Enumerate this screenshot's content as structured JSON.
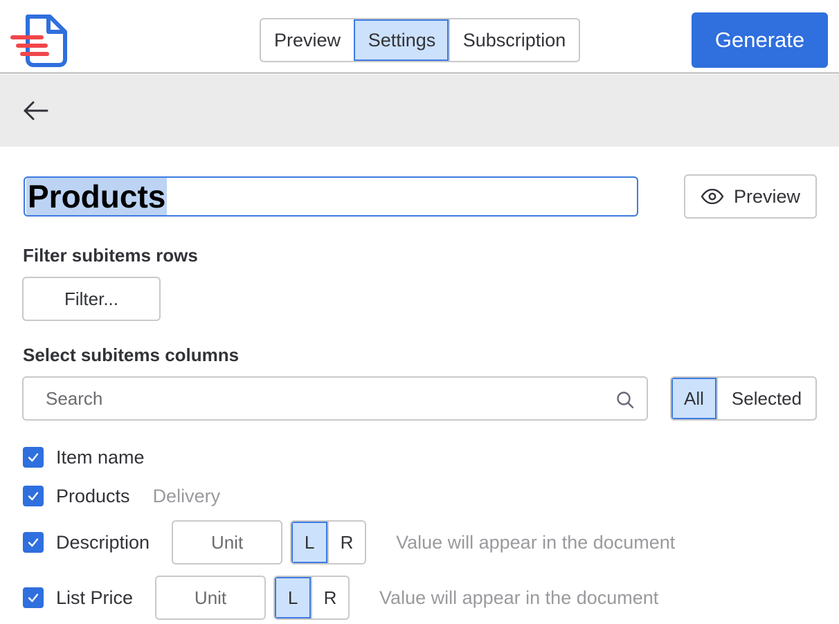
{
  "header": {
    "tabs": [
      {
        "label": "Preview",
        "active": false
      },
      {
        "label": "Settings",
        "active": true
      },
      {
        "label": "Subscription",
        "active": false
      }
    ],
    "generate_label": "Generate"
  },
  "toolbar": {
    "back_icon": "arrow-left-icon"
  },
  "editor": {
    "title_value": "Products",
    "preview_label": "Preview",
    "preview_icon": "eye-icon"
  },
  "filter": {
    "heading": "Filter subitems rows",
    "button_label": "Filter..."
  },
  "columns": {
    "heading": "Select subitems columns",
    "search_placeholder": "Search",
    "view_options": [
      {
        "label": "All",
        "active": true
      },
      {
        "label": "Selected",
        "active": false
      }
    ],
    "items": [
      {
        "label": "Item name",
        "checked": true
      },
      {
        "label": "Products",
        "checked": true,
        "hint": "Delivery"
      },
      {
        "label": "Description",
        "checked": true,
        "unit_placeholder": "Unit",
        "align_left": "L",
        "align_right": "R",
        "align_active": "L",
        "hint": "Value will appear in the document"
      },
      {
        "label": "List Price",
        "checked": true,
        "unit_placeholder": "Unit",
        "align_left": "L",
        "align_right": "R",
        "align_active": "L",
        "hint": "Value will appear in the document"
      }
    ]
  },
  "colors": {
    "accent": "#2f6fde",
    "selected_bg": "#cce1fb",
    "logo_red": "#f0464b"
  }
}
